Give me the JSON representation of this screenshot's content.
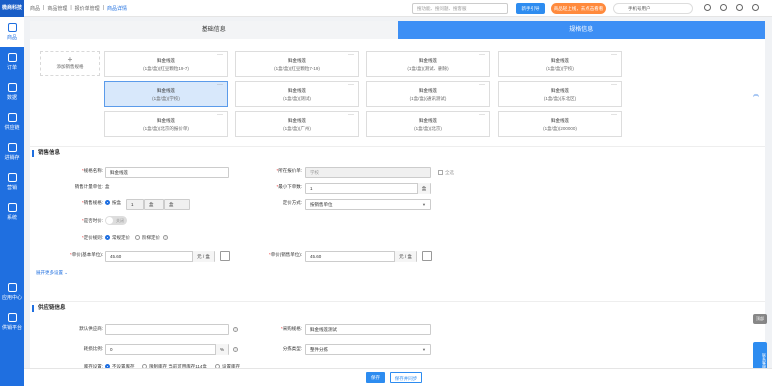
{
  "brand": "微商科技",
  "nav": [
    {
      "label": "商品",
      "icon": "home-icon"
    },
    {
      "label": "订单",
      "icon": "order-icon"
    },
    {
      "label": "数据",
      "icon": "chart-icon"
    },
    {
      "label": "供应链",
      "icon": "supply-chain-icon"
    },
    {
      "label": "进销存",
      "icon": "inventory-icon"
    },
    {
      "label": "营销",
      "icon": "marketing-icon"
    },
    {
      "label": "系统",
      "icon": "settings-icon"
    },
    {
      "label": "应用中心",
      "icon": "apps-icon"
    },
    {
      "label": "供销平台",
      "icon": "platform-icon"
    }
  ],
  "breadcrumb": [
    "商品",
    "商品管理",
    "报价单管理",
    "商品详情"
  ],
  "search": {
    "placeholder": "搜功能、搜问题、搜客服"
  },
  "header": {
    "new_button": "新手引导",
    "promo": "商品轻上线，去点击看看",
    "user_name": "手机号用户"
  },
  "tabs": [
    "基础信息",
    "规格信息"
  ],
  "add_spec": "添加销售规格",
  "spec_cards": [
    {
      "name": "鲜金线莲",
      "desc": "(1盒/盒)(红豆颗粒19-7)"
    },
    {
      "name": "鲜金线莲",
      "desc": "(1盒/盒)(红豆颗粒7-19)"
    },
    {
      "name": "鲜金线莲",
      "desc": "(1盒/盒)(测试、删除)"
    },
    {
      "name": "鲜金线莲",
      "desc": "(1盒/盒)(学校)"
    },
    {
      "name": "鲜金线莲",
      "desc": "(1盒/盒)(学校)"
    },
    {
      "name": "鲜金线莲",
      "desc": "(1盒/盒)(测试)"
    },
    {
      "name": "鲜金线莲",
      "desc": "(1盒/盒)(通讯测试)"
    },
    {
      "name": "鲜金线莲",
      "desc": "(1盒/盒)(东北区)"
    },
    {
      "name": "鲜金线莲",
      "desc": "(1盒/盒)(北京的报价单)"
    },
    {
      "name": "鲜金线莲",
      "desc": "(1盒/盒)(广州)"
    },
    {
      "name": "鲜金线莲",
      "desc": "(1盒/盒)(北京)"
    },
    {
      "name": "鲜金线莲",
      "desc": "(1盒/盒)(200000)"
    }
  ],
  "sales": {
    "title": "销售信息",
    "spec_name_label": "规格名称:",
    "spec_name_value": "鲜金线莲",
    "quote_label": "所在报价单:",
    "quote_value": "学校",
    "all_label": "全选",
    "unit_label": "销售计量单位:",
    "unit_value": "盒",
    "min_order_label": "最小下单数:",
    "min_order_value": "1",
    "min_order_unit": "盒",
    "sale_spec_label": "销售规格:",
    "sale_spec_option": "按盒",
    "sale_spec_qty": "1",
    "sale_spec_unit1": "盒",
    "sale_spec_unit2": "盒",
    "pricing_label": "定价方式:",
    "pricing_value": "按销售单位",
    "time_price_label": "是否时价:",
    "time_price_toggle": "关闭",
    "pricing_rule_label": "定价规则:",
    "rule_normal": "常规定价",
    "rule_step": "阶梯定价",
    "unit_price_label": "单价(基本单位):",
    "unit_price_value": "45.60",
    "unit_price_unit": "元 / 盒",
    "sale_price_label": "单价(销售单位):",
    "sale_price_value": "45.60",
    "sale_price_unit": "元 / 盒",
    "more": "展开更多设置"
  },
  "supply": {
    "title": "供应链信息",
    "supplier_label": "默认供应商:",
    "purchase_spec_label": "采购规格:",
    "purchase_spec_value": "鲜金线莲测试",
    "loss_label": "耗损比例:",
    "loss_value": "0",
    "loss_unit": "%",
    "sort_label": "分拣类型:",
    "sort_value": "整件分拣",
    "stock_label": "库存设置:",
    "stock_opt1": "不设置库存",
    "stock_opt2": "限制库存 当前可用库存114盒",
    "stock_opt3": "设置库存"
  },
  "footer": {
    "save": "保存",
    "save_sync": "保存并同步"
  },
  "side_float": {
    "top": "顶部",
    "service": "联系客服"
  }
}
